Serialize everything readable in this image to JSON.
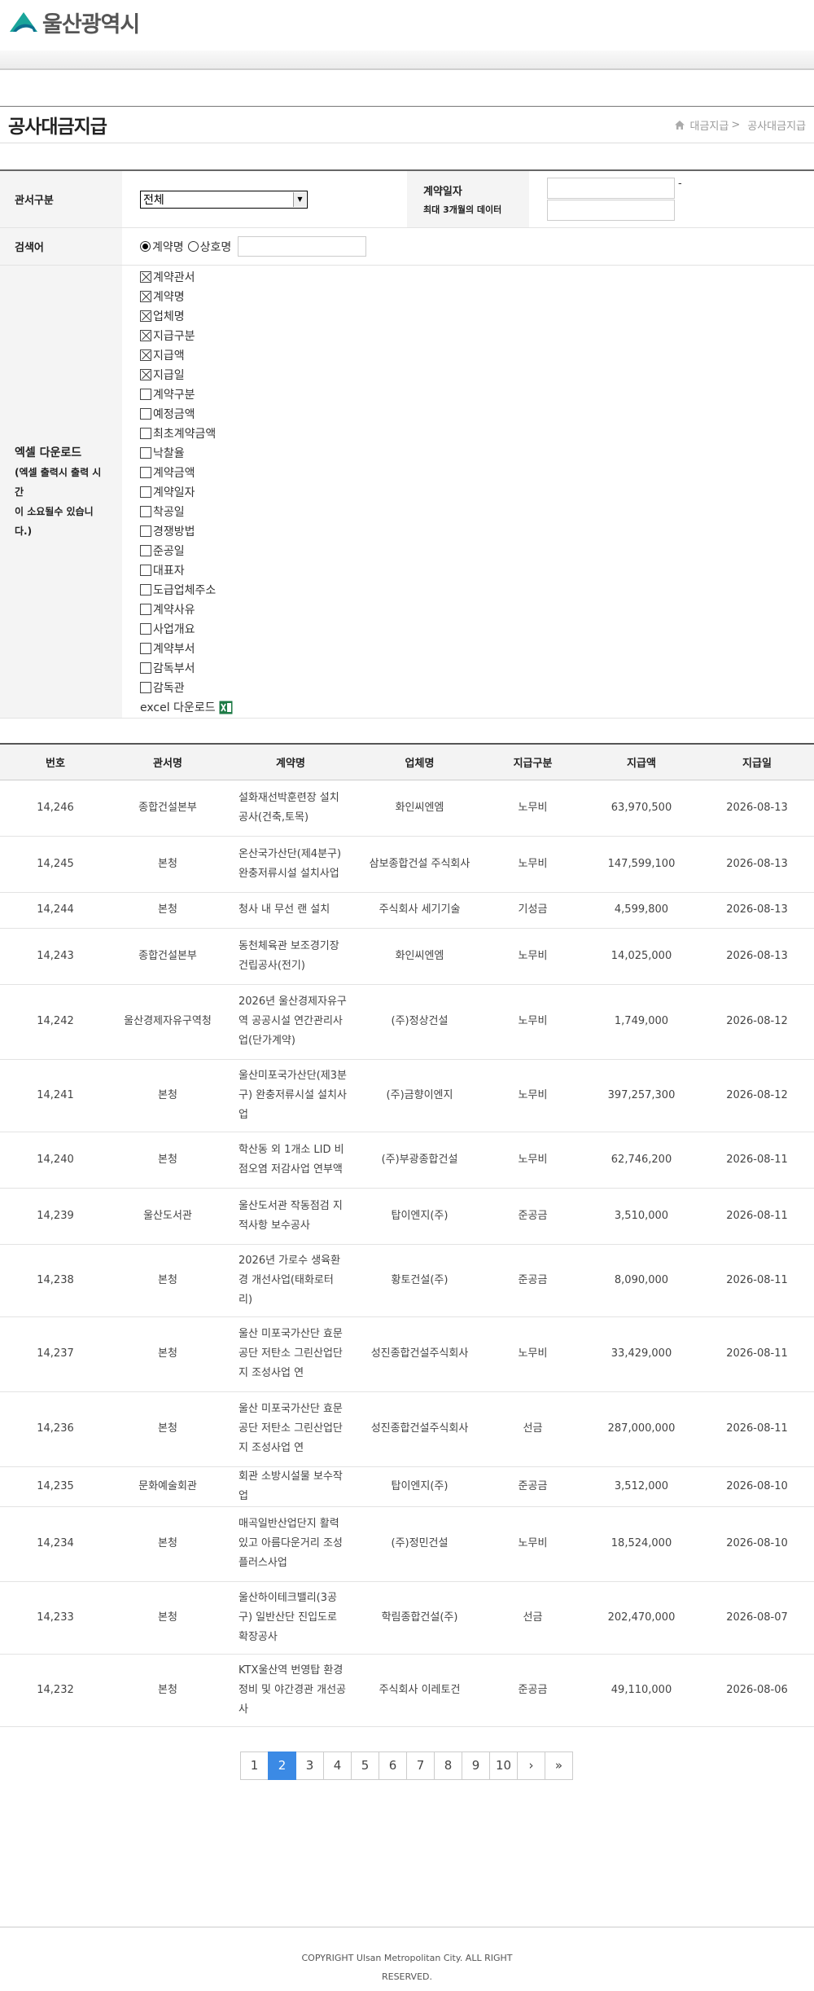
{
  "header": {
    "logo_text": "울산광역시"
  },
  "title": "공사대금지급",
  "breadcrumb": {
    "item1": "대금지급",
    "sep": ">",
    "item2": "공사대금지급"
  },
  "form": {
    "office_label": "관서구분",
    "office_value": "전체",
    "date_label": "계약일자",
    "date_note": "최대 3개월의 데이터",
    "date_sep": "-",
    "keyword_label": "검색어",
    "radio_contract": "계약명",
    "radio_company": "상호명",
    "excel_label_lines": [
      "엑셀 다운로드",
      "(엑셀 출력시 출력 시간",
      "이 소요될수 있습니다.)"
    ],
    "excel_fields": [
      {
        "label": "계약관서",
        "checked": true
      },
      {
        "label": "계약명",
        "checked": true
      },
      {
        "label": "업체명",
        "checked": true
      },
      {
        "label": "지급구분",
        "checked": true
      },
      {
        "label": "지급액",
        "checked": true
      },
      {
        "label": "지급일",
        "checked": true
      },
      {
        "label": "계약구분",
        "checked": false
      },
      {
        "label": "예정금액",
        "checked": false
      },
      {
        "label": "최초계약금액",
        "checked": false
      },
      {
        "label": "낙찰율",
        "checked": false
      },
      {
        "label": "계약금액",
        "checked": false
      },
      {
        "label": "계약일자",
        "checked": false
      },
      {
        "label": "착공일",
        "checked": false
      },
      {
        "label": "경쟁방법",
        "checked": false
      },
      {
        "label": "준공일",
        "checked": false
      },
      {
        "label": "대표자",
        "checked": false
      },
      {
        "label": "도급업체주소",
        "checked": false
      },
      {
        "label": "계약사유",
        "checked": false
      },
      {
        "label": "사업개요",
        "checked": false
      },
      {
        "label": "계약부서",
        "checked": false
      },
      {
        "label": "감독부서",
        "checked": false
      },
      {
        "label": "감독관",
        "checked": false
      }
    ],
    "excel_download": "excel 다운로드"
  },
  "table": {
    "headers": [
      "번호",
      "관서명",
      "계약명",
      "업체명",
      "지급구분",
      "지급액",
      "지급일"
    ],
    "rows": [
      {
        "no": "14,246",
        "office": "종합건설본부",
        "contract": "설화재선박훈련장 설치공사(건축,토목)",
        "company": "화인씨엔엠",
        "type": "노무비",
        "amount": "63,970,500",
        "date": "2026-08-13",
        "h": "h2"
      },
      {
        "no": "14,245",
        "office": "본청",
        "contract": "온산국가산단(제4분구)완충저류시설 설치사업",
        "company": "삼보종합건설 주식회사",
        "type": "노무비",
        "amount": "147,599,100",
        "date": "2026-08-13",
        "h": "h2"
      },
      {
        "no": "14,244",
        "office": "본청",
        "contract": "청사 내 무선 랜 설치",
        "company": "주식회사 세기기술",
        "type": "기성금",
        "amount": "4,599,800",
        "date": "2026-08-13",
        "h": "h1"
      },
      {
        "no": "14,243",
        "office": "종합건설본부",
        "contract": "동천체육관 보조경기장 건립공사(전기)",
        "company": "화인씨엔엠",
        "type": "노무비",
        "amount": "14,025,000",
        "date": "2026-08-13",
        "h": "h2"
      },
      {
        "no": "14,242",
        "office": "울산경제자유구역청",
        "contract": "2026년 울산경제자유구역 공공시설 연간관리사업(단가계약)",
        "company": "(주)정상건설",
        "type": "노무비",
        "amount": "1,749,000",
        "date": "2026-08-12",
        "h": "h3"
      },
      {
        "no": "14,241",
        "office": "본청",
        "contract": "울산미포국가산단(제3분구) 완충저류시설 설치사업",
        "company": "(주)금향이엔지",
        "type": "노무비",
        "amount": "397,257,300",
        "date": "2026-08-12",
        "h": "h2"
      },
      {
        "no": "14,240",
        "office": "본청",
        "contract": "학산동 외 1개소 LID 비점오염 저감사업 연부액",
        "company": "(주)부광종합건설",
        "type": "노무비",
        "amount": "62,746,200",
        "date": "2026-08-11",
        "h": "h2"
      },
      {
        "no": "14,239",
        "office": "울산도서관",
        "contract": "울산도서관 작동점검 지적사항 보수공사",
        "company": "탑이엔지(주)",
        "type": "준공금",
        "amount": "3,510,000",
        "date": "2026-08-11",
        "h": "h2"
      },
      {
        "no": "14,238",
        "office": "본청",
        "contract": "2026년 가로수 생육환경 개선사업(태화로터리)",
        "company": "황토건설(주)",
        "type": "준공금",
        "amount": "8,090,000",
        "date": "2026-08-11",
        "h": "h2"
      },
      {
        "no": "14,237",
        "office": "본청",
        "contract": "울산 미포국가산단 효문공단 저탄소 그린산업단지 조성사업 연",
        "company": "성진종합건설주식회사",
        "type": "노무비",
        "amount": "33,429,000",
        "date": "2026-08-11",
        "h": "h3"
      },
      {
        "no": "14,236",
        "office": "본청",
        "contract": "울산 미포국가산단 효문공단 저탄소 그린산업단지 조성사업 연",
        "company": "성진종합건설주식회사",
        "type": "선금",
        "amount": "287,000,000",
        "date": "2026-08-11",
        "h": "h3"
      },
      {
        "no": "14,235",
        "office": "문화예술회관",
        "contract": "회관 소방시설물 보수작업",
        "company": "탑이엔지(주)",
        "type": "준공금",
        "amount": "3,512,000",
        "date": "2026-08-10",
        "h": "h1"
      },
      {
        "no": "14,234",
        "office": "본청",
        "contract": "매곡일반산업단지 활력있고 아름다운거리 조성 플러스사업",
        "company": "(주)정민건설",
        "type": "노무비",
        "amount": "18,524,000",
        "date": "2026-08-10",
        "h": "h3"
      },
      {
        "no": "14,233",
        "office": "본청",
        "contract": "울산하이테크밸리(3공구) 일반산단 진입도로 확장공사",
        "company": "학림종합건설(주)",
        "type": "선금",
        "amount": "202,470,000",
        "date": "2026-08-07",
        "h": "h2"
      },
      {
        "no": "14,232",
        "office": "본청",
        "contract": "KTX울산역 번영탑 환경정비 및 야간경관 개선공사",
        "company": "주식회사 이레토건",
        "type": "준공금",
        "amount": "49,110,000",
        "date": "2026-08-06",
        "h": "h2"
      }
    ]
  },
  "paging": {
    "pages": [
      "1",
      "2",
      "3",
      "4",
      "5",
      "6",
      "7",
      "8",
      "9",
      "10"
    ],
    "current": "2",
    "next": "›",
    "last": "»"
  },
  "footer": {
    "text": "COPYRIGHT    Ulsan Metropolitan City. ALL RIGHT RESERVED."
  },
  "colors": {
    "accent": "#3b8ae5",
    "logo": "#1aa59a",
    "excel_icon": "#1d7a45"
  },
  "icons": {
    "home": "home-icon",
    "excel": "excel-file-icon",
    "logo": "ulsan-logo-mark"
  }
}
